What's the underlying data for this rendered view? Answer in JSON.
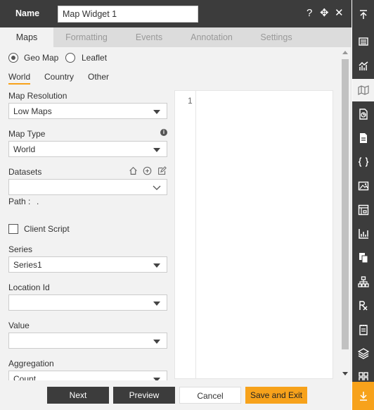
{
  "header": {
    "name_label": "Name",
    "widget_name": "Map Widget 1",
    "help_icon": "?",
    "move_icon": "✥",
    "close_icon": "✕"
  },
  "tabs": [
    {
      "label": "Maps",
      "active": true
    },
    {
      "label": "Formatting",
      "active": false
    },
    {
      "label": "Events",
      "active": false
    },
    {
      "label": "Annotation",
      "active": false
    },
    {
      "label": "Settings",
      "active": false
    }
  ],
  "map_source": {
    "options": [
      {
        "label": "Geo Map",
        "selected": true
      },
      {
        "label": "Leaflet",
        "selected": false
      }
    ]
  },
  "region_tabs": [
    {
      "label": "World",
      "active": true
    },
    {
      "label": "Country",
      "active": false
    },
    {
      "label": "Other",
      "active": false
    }
  ],
  "fields": {
    "map_resolution": {
      "label": "Map Resolution",
      "value": "Low Maps"
    },
    "map_type": {
      "label": "Map Type",
      "value": "World"
    },
    "datasets": {
      "label": "Datasets",
      "value": ""
    },
    "path": {
      "label": "Path :",
      "value": "."
    },
    "client_script": {
      "label": "Client Script",
      "checked": false
    },
    "series": {
      "label": "Series",
      "value": "Series1"
    },
    "location_id": {
      "label": "Location Id",
      "value": ""
    },
    "value": {
      "label": "Value",
      "value": ""
    },
    "aggregation": {
      "label": "Aggregation",
      "value": "Count"
    }
  },
  "editor": {
    "line_number": "1"
  },
  "footer": {
    "next": "Next",
    "preview": "Preview",
    "cancel": "Cancel",
    "save_exit": "Save and Exit"
  },
  "colors": {
    "header_bg": "#3c3c3c",
    "accent_orange": "#f7a21b",
    "dark_button": "#3c3c3c"
  },
  "toolbar_icons": [
    "collapse-up-icon",
    "list-icon",
    "analytics-chart-icon",
    "map-icon",
    "document-chart-icon",
    "file-icon",
    "code-braces-icon",
    "image-icon",
    "frame-icon",
    "bar-chart-icon",
    "copy-icon",
    "hierarchy-icon",
    "rx-icon",
    "notepad-icon",
    "layers-icon",
    "widgets-icon",
    "collapse-down-icon"
  ]
}
